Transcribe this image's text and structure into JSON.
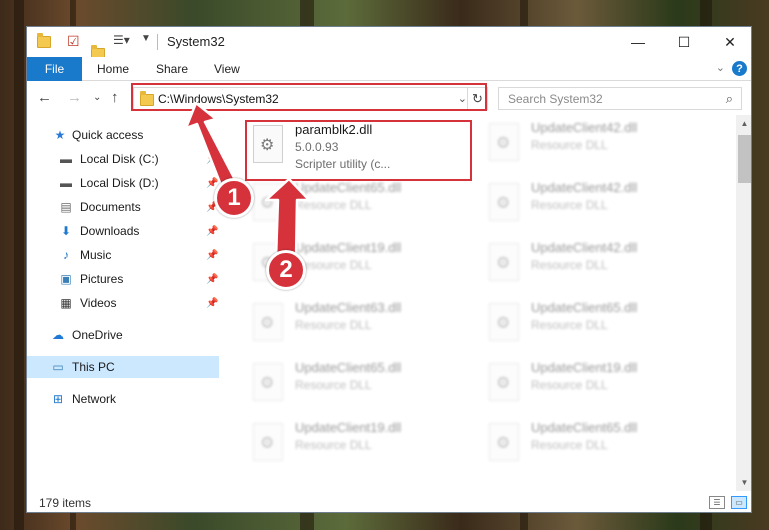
{
  "window": {
    "title": "System32",
    "controls": {
      "minimize": "—",
      "maximize": "☐",
      "close": "✕"
    }
  },
  "ribbon": {
    "tabs": [
      "File",
      "Home",
      "Share",
      "View"
    ],
    "help": "?"
  },
  "address": {
    "path": "C:\\Windows\\System32",
    "search_placeholder": "Search System32"
  },
  "nav": {
    "items": [
      {
        "label": "Quick access",
        "icon": "star-icon"
      },
      {
        "label": "Local Disk (C:)",
        "icon": "drive-icon",
        "pinned": true
      },
      {
        "label": "Local Disk (D:)",
        "icon": "drive-icon",
        "pinned": true
      },
      {
        "label": "Documents",
        "icon": "documents-icon",
        "pinned": true
      },
      {
        "label": "Downloads",
        "icon": "downloads-icon",
        "pinned": true
      },
      {
        "label": "Music",
        "icon": "music-icon",
        "pinned": true
      },
      {
        "label": "Pictures",
        "icon": "pictures-icon",
        "pinned": true
      },
      {
        "label": "Videos",
        "icon": "videos-icon",
        "pinned": true
      },
      {
        "label": "OneDrive",
        "icon": "cloud-icon"
      },
      {
        "label": "This PC",
        "icon": "computer-icon",
        "selected": true
      },
      {
        "label": "Network",
        "icon": "network-icon"
      }
    ]
  },
  "files": {
    "highlighted": {
      "name": "paramblk2.dll",
      "version": "5.0.0.93",
      "description": "Scripter utility (c..."
    },
    "left_column": [
      {
        "name": "UpdateClient65.dll",
        "type": "Resource DLL"
      },
      {
        "name": "UpdateClient19.dll",
        "type": "Resource DLL"
      },
      {
        "name": "UpdateClient63.dll",
        "type": "Resource DLL"
      },
      {
        "name": "UpdateClient65.dll",
        "type": "Resource DLL"
      },
      {
        "name": "UpdateClient19.dll",
        "type": "Resource DLL"
      }
    ],
    "right_column": [
      {
        "name": "UpdateClient42.dll",
        "type": "Resource DLL"
      },
      {
        "name": "UpdateClient42.dll",
        "type": "Resource DLL"
      },
      {
        "name": "UpdateClient42.dll",
        "type": "Resource DLL"
      },
      {
        "name": "UpdateClient65.dll",
        "type": "Resource DLL"
      },
      {
        "name": "UpdateClient19.dll",
        "type": "Resource DLL"
      },
      {
        "name": "UpdateClient65.dll",
        "type": "Resource DLL"
      }
    ]
  },
  "status": {
    "item_count": "179 items"
  },
  "annotations": {
    "badge1": "1",
    "badge2": "2",
    "accent_color": "#d6323c"
  }
}
